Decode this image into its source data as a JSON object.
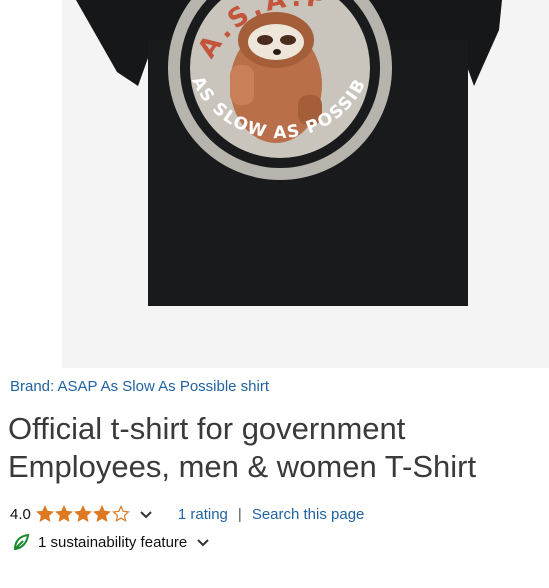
{
  "product": {
    "image_alt": "Black t-shirt with sloth graphic",
    "graphic": {
      "arc_top": "A.S.A.P",
      "arc_bottom": "AS SLOW AS POSSIBLE"
    },
    "brand_link": "Brand: ASAP As Slow As Possible shirt",
    "title": "Official t-shirt for government Employees, men & women T-Shirt"
  },
  "rating": {
    "value": "4.0",
    "stars": 4,
    "stars_max": 5,
    "ratings_link": "1 rating",
    "separator": "|",
    "search_link": "Search this page"
  },
  "sustainability": {
    "label": "1 sustainability feature"
  },
  "colors": {
    "link": "#2162a1",
    "star": "#de7921",
    "leaf": "#1a8a2e",
    "shirt": "#151718"
  },
  "icons": {
    "star": "star-icon",
    "chevron": "chevron-down-icon",
    "leaf": "leaf-icon"
  }
}
